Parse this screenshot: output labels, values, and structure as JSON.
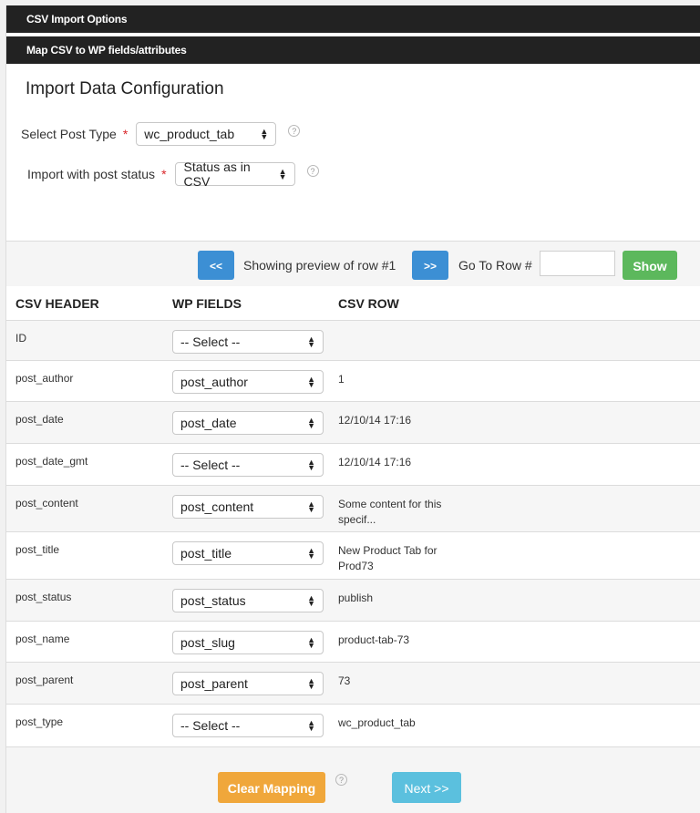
{
  "bars": {
    "import_options": "CSV Import Options",
    "map_fields": "Map CSV to WP fields/attributes"
  },
  "config": {
    "title": "Import Data Configuration",
    "post_type_label": "Select Post Type",
    "post_type_value": "wc_product_tab",
    "post_status_label": "Import with post status",
    "post_status_value": "Status as in CSV",
    "required_mark": "*",
    "help_glyph": "?"
  },
  "nav": {
    "prev_label": "<<",
    "showing_text": "Showing preview of row #1",
    "next_label": ">>",
    "goto_label": "Go To Row #",
    "goto_value": "",
    "show_label": "Show"
  },
  "table": {
    "headers": [
      "CSV HEADER",
      "WP FIELDS",
      "CSV ROW"
    ],
    "rows": [
      {
        "csv_header": "ID",
        "wp_field": "-- Select --",
        "csv_row": ""
      },
      {
        "csv_header": "post_author",
        "wp_field": "post_author",
        "csv_row": "1"
      },
      {
        "csv_header": "post_date",
        "wp_field": "post_date",
        "csv_row": "12/10/14 17:16"
      },
      {
        "csv_header": "post_date_gmt",
        "wp_field": "-- Select --",
        "csv_row": "12/10/14 17:16"
      },
      {
        "csv_header": "post_content",
        "wp_field": "post_content",
        "csv_row": "Some content for this specif..."
      },
      {
        "csv_header": "post_title",
        "wp_field": "post_title",
        "csv_row": "New Product Tab for Prod73"
      },
      {
        "csv_header": "post_status",
        "wp_field": "post_status",
        "csv_row": "publish"
      },
      {
        "csv_header": "post_name",
        "wp_field": "post_slug",
        "csv_row": "product-tab-73"
      },
      {
        "csv_header": "post_parent",
        "wp_field": "post_parent",
        "csv_row": "73"
      },
      {
        "csv_header": "post_type",
        "wp_field": "-- Select --",
        "csv_row": "wc_product_tab"
      }
    ]
  },
  "footer": {
    "clear_label": "Clear Mapping",
    "next_label": "Next >>",
    "help_glyph": "?"
  },
  "colors": {
    "bar_bg": "#222222",
    "blue": "#3c8fd4",
    "green": "#5cb85c",
    "orange": "#f0a73b",
    "cyan": "#5bc0de",
    "required": "#d9262a"
  }
}
